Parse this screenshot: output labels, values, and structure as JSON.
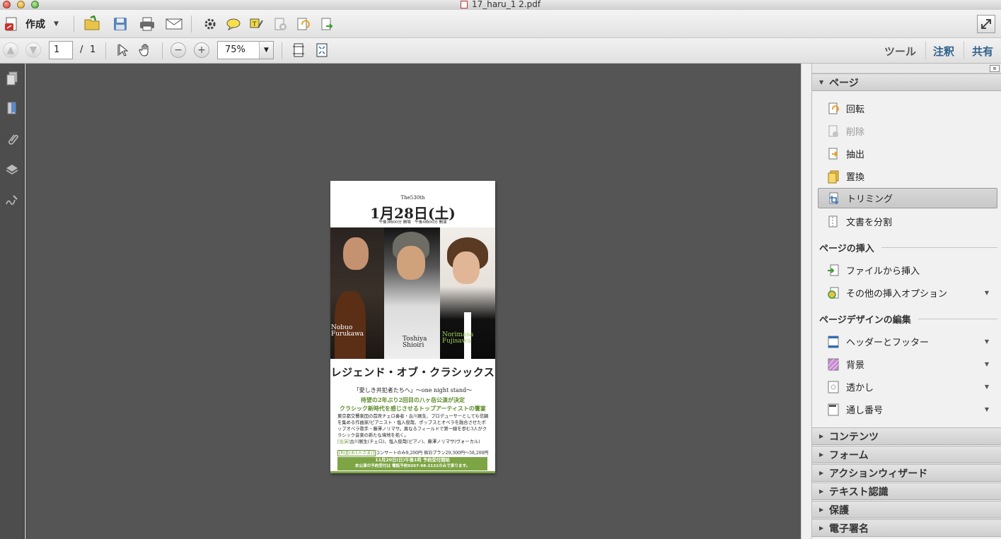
{
  "window": {
    "title": "17_haru_1 2.pdf"
  },
  "toolbar1": {
    "create_label": "作成",
    "icons": [
      "create-pdf-icon",
      "open-icon",
      "save-icon",
      "print-icon",
      "email-icon",
      "settings-icon",
      "comment-icon",
      "highlight-icon",
      "delete-pages-icon",
      "rotate-pages-icon",
      "export-icon",
      "expand-icon"
    ]
  },
  "toolbar2": {
    "page_value": "1",
    "page_separator": "/",
    "page_total": "1",
    "zoom_value": "75%",
    "tools_label": "ツール",
    "comment_label": "注釈",
    "share_label": "共有"
  },
  "document": {
    "edition": "The530th",
    "date": "1月28日(土)",
    "time": "午後3時00分 開場　午後4時00分 開演",
    "caption1": "Nobuo\nFurukawa",
    "caption2": "Toshiya\nShioiri",
    "caption3": "Norimasa\nFujisawa",
    "title": "レジェンド・オブ・クラシックス",
    "subtitle": "「愛しき共犯者たちへ」〜one night stand〜",
    "green_line1": "待望の2年ぶり2回目の八ヶ岳公演が決定",
    "green_line2": "クラシック新時代を感じさせるトップアーティストの饗宴",
    "body": "東京都交響楽団の首席チェロ奏者・古川展生、プロデューサーとしても信頼を集める作曲家/ピアニスト・塩入俊哉、ポップスとオペラを融合させたポップオペラ歌手・藤澤ノリマサ。異なるフィールドで第一線を歩む3人がクラシック音楽の新たな境地を拓く。",
    "performers_tag": "[出演]",
    "performers": "古川展生(チェロ)、塩入俊哉(ピアノ)、藤澤ノリマサ(ヴォーカル)",
    "price_tag": "[料金(お1人さま)]",
    "price": "コンサートのみ9,200円 宿泊プラン29,300円〜58,200円",
    "band_line1": "11月20日(日)午後1時 予約受付開始",
    "band_line2": "本公演の予約受付は 電話予約0267-98-2131のみで承ります。"
  },
  "panel": {
    "page_section": "ページ",
    "items": [
      {
        "label": "回転",
        "icon": "rotate-icon",
        "enabled": true
      },
      {
        "label": "削除",
        "icon": "delete-icon",
        "enabled": false
      },
      {
        "label": "抽出",
        "icon": "extract-icon",
        "enabled": true
      },
      {
        "label": "置換",
        "icon": "replace-icon",
        "enabled": true
      },
      {
        "label": "トリミング",
        "icon": "crop-icon",
        "enabled": true,
        "selected": true
      },
      {
        "label": "文書を分割",
        "icon": "split-icon",
        "enabled": true
      }
    ],
    "insert_group": "ページの挿入",
    "insert_items": [
      {
        "label": "ファイルから挿入",
        "icon": "insert-file-icon"
      },
      {
        "label": "その他の挿入オプション",
        "icon": "more-insert-icon",
        "dropdown": true
      }
    ],
    "design_group": "ページデザインの編集",
    "design_items": [
      {
        "label": "ヘッダーとフッター",
        "icon": "header-footer-icon",
        "dropdown": true
      },
      {
        "label": "背景",
        "icon": "background-icon",
        "dropdown": true
      },
      {
        "label": "透かし",
        "icon": "watermark-icon",
        "dropdown": true
      },
      {
        "label": "通し番号",
        "icon": "bates-number-icon",
        "dropdown": true
      }
    ],
    "collapsed_sections": [
      "コンテンツ",
      "フォーム",
      "アクションウィザード",
      "テキスト認識",
      "保護",
      "電子署名"
    ]
  }
}
